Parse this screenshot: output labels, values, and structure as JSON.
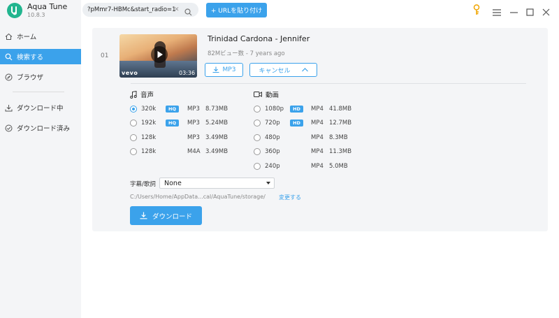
{
  "app": {
    "name": "Aqua Tune",
    "version": "10.8.3",
    "logo_glyph": "g",
    "accent": "#3ba2eb",
    "logo_color": "#21b58f"
  },
  "sidebar": {
    "items": [
      {
        "label": "ホーム",
        "icon": "home-icon",
        "active": false
      },
      {
        "label": "検索する",
        "icon": "search-icon",
        "active": true
      },
      {
        "label": "ブラウザ",
        "icon": "compass-icon",
        "active": false
      },
      {
        "label": "ダウンロード中",
        "icon": "download-icon",
        "active": false
      },
      {
        "label": "ダウンロード済み",
        "icon": "check-circle-icon",
        "active": false
      }
    ]
  },
  "topbar": {
    "url_value": "?pMmr7-HBMc&start_radio=1",
    "clear_glyph": "✕",
    "paste_label": "+ URLを貼り付け"
  },
  "video": {
    "index": "01",
    "title": "Trinidad Cardona - Jennifer",
    "meta": "82Mビュー数 - 7 years ago",
    "vevo": "vevo",
    "duration": "03:36",
    "mp3_label": "MP3",
    "cancel_label": "キャンセル"
  },
  "audio": {
    "heading": "音声",
    "rows": [
      {
        "quality": "320k",
        "hq": "HQ",
        "format": "MP3",
        "size": "8.73MB",
        "selected": true
      },
      {
        "quality": "192k",
        "hq": "HQ",
        "format": "MP3",
        "size": "5.24MB",
        "selected": false
      },
      {
        "quality": "128k",
        "hq": "",
        "format": "MP3",
        "size": "3.49MB",
        "selected": false
      },
      {
        "quality": "128k",
        "hq": "",
        "format": "M4A",
        "size": "3.49MB",
        "selected": false
      }
    ]
  },
  "videoFormats": {
    "heading": "動画",
    "rows": [
      {
        "quality": "1080p",
        "hd": "HD",
        "format": "MP4",
        "size": "41.8MB"
      },
      {
        "quality": "720p",
        "hd": "HD",
        "format": "MP4",
        "size": "12.7MB"
      },
      {
        "quality": "480p",
        "hd": "",
        "format": "MP4",
        "size": "8.3MB"
      },
      {
        "quality": "360p",
        "hd": "",
        "format": "MP4",
        "size": "11.3MB"
      },
      {
        "quality": "240p",
        "hd": "",
        "format": "MP4",
        "size": "5.0MB"
      }
    ]
  },
  "subtitles": {
    "label": "字幕/歌詞",
    "value": "None"
  },
  "output": {
    "path": "C:/Users/Home/AppData...cal/AquaTune/storage/",
    "change_label": "変更する"
  },
  "download_label": "ダウンロード"
}
